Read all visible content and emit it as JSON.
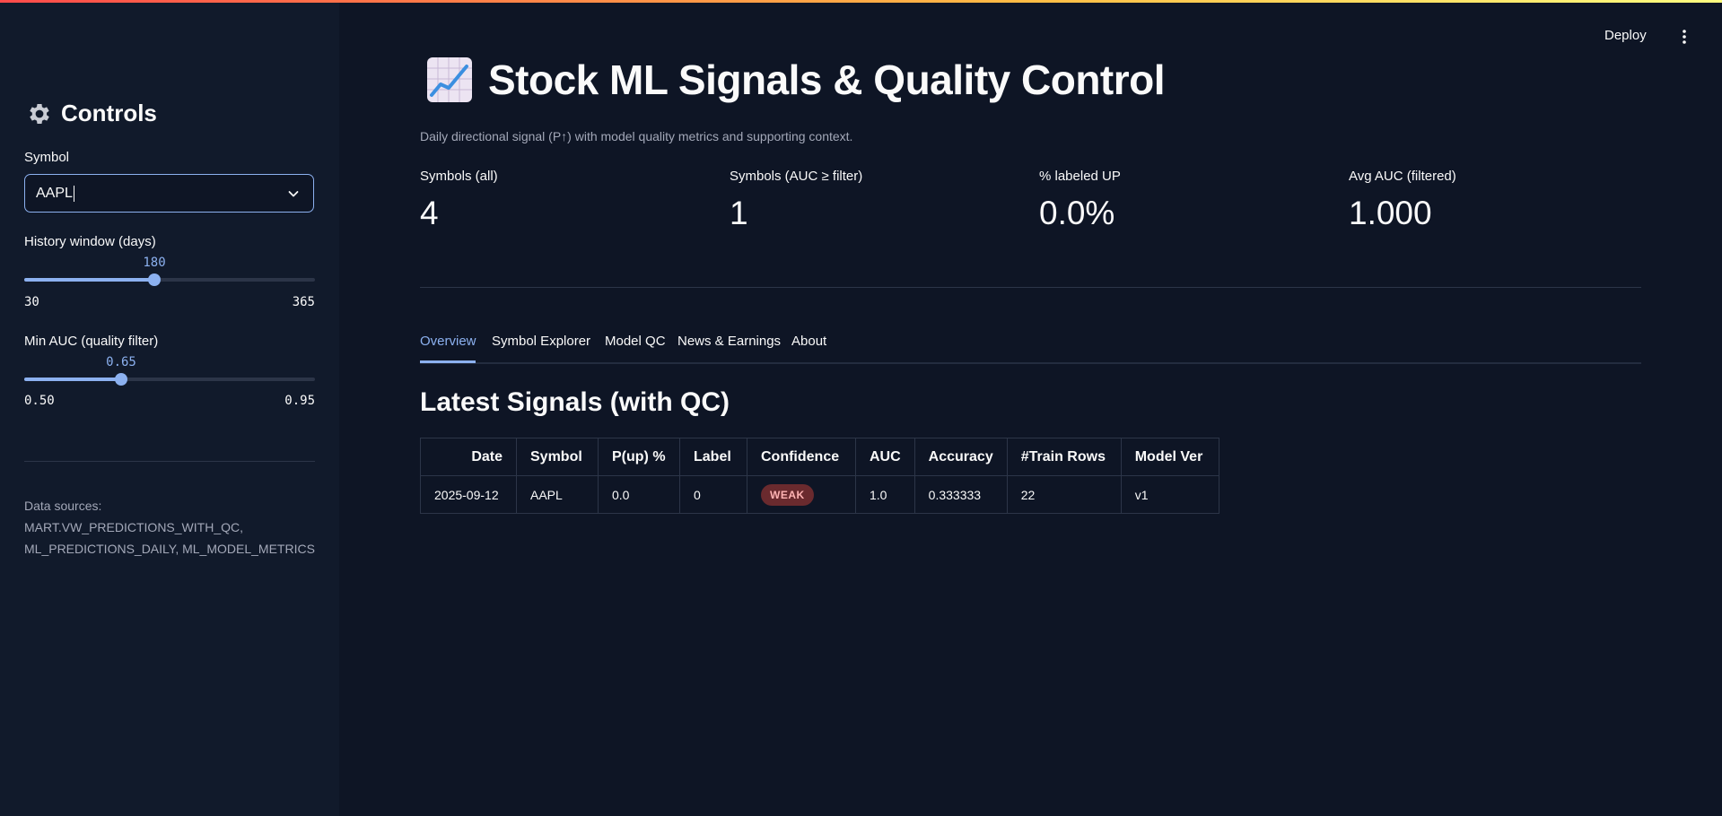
{
  "sidebar": {
    "header": "Controls",
    "symbol": {
      "label": "Symbol",
      "value": "AAPL"
    },
    "history": {
      "label": "History window (days)",
      "value": "180",
      "min": "30",
      "max": "365",
      "fraction": 0.448
    },
    "auc": {
      "label": "Min AUC (quality filter)",
      "value": "0.65",
      "min": "0.50",
      "max": "0.95",
      "fraction": 0.333
    },
    "sources": "Data sources: MART.VW_PREDICTIONS_WITH_QC, ML_PREDICTIONS_DAILY, ML_MODEL_METRICS"
  },
  "header": {
    "deploy": "Deploy"
  },
  "main": {
    "title": "Stock ML Signals & Quality Control",
    "caption": "Daily directional signal (P↑) with model quality metrics and supporting context.",
    "metrics": [
      {
        "label": "Symbols (all)",
        "value": "4"
      },
      {
        "label": "Symbols (AUC ≥ filter)",
        "value": "1"
      },
      {
        "label": "% labeled UP",
        "value": "0.0%"
      },
      {
        "label": "Avg AUC (filtered)",
        "value": "1.000"
      }
    ],
    "tabs": [
      "Overview",
      "Symbol Explorer",
      "Model QC",
      "News & Earnings",
      "About"
    ],
    "section_title": "Latest Signals (with QC)",
    "table": {
      "headers": [
        "Date",
        "Symbol",
        "P(up) %",
        "Label",
        "Confidence",
        "AUC",
        "Accuracy",
        "#Train Rows",
        "Model Ver"
      ],
      "rows": [
        [
          "2025-09-12",
          "AAPL",
          "0.0",
          "0",
          "WEAK",
          "1.0",
          "0.333333",
          "22",
          "v1"
        ]
      ]
    }
  },
  "colors": {
    "accent": "#8cb1f0",
    "weak_badge_bg": "#6a2a2e",
    "weak_badge_text": "#ffb3b3"
  }
}
